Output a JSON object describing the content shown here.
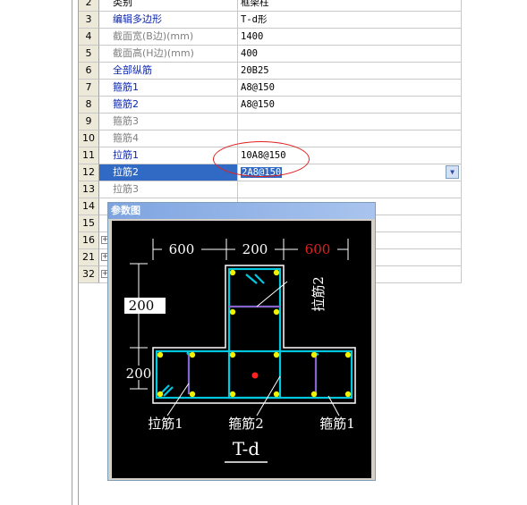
{
  "rows": [
    {
      "num": "2",
      "name": "类别",
      "value": "框架柱",
      "name_style": "black"
    },
    {
      "num": "3",
      "name": "编辑多边形",
      "value": "T-d形",
      "name_style": "blue"
    },
    {
      "num": "4",
      "name": "截面宽(B边)(mm)",
      "value": "1400",
      "name_style": "gray"
    },
    {
      "num": "5",
      "name": "截面高(H边)(mm)",
      "value": "400",
      "name_style": "gray"
    },
    {
      "num": "6",
      "name": "全部纵筋",
      "value": "20B25",
      "name_style": "blue"
    },
    {
      "num": "7",
      "name": "箍筋1",
      "value": "A8@150",
      "name_style": "blue"
    },
    {
      "num": "8",
      "name": "箍筋2",
      "value": "A8@150",
      "name_style": "blue"
    },
    {
      "num": "9",
      "name": "箍筋3",
      "value": "",
      "name_style": "gray"
    },
    {
      "num": "10",
      "name": "箍筋4",
      "value": "",
      "name_style": "gray"
    },
    {
      "num": "11",
      "name": "拉筋1",
      "value": "10A8@150",
      "name_style": "blue"
    },
    {
      "num": "12",
      "name": "拉筋2",
      "value": "2A8@150",
      "name_style": "selected"
    },
    {
      "num": "13",
      "name": "拉筋3",
      "value": "",
      "name_style": "gray"
    },
    {
      "num": "14",
      "name": "",
      "value": "",
      "name_style": "black"
    },
    {
      "num": "15",
      "name": "",
      "value": "",
      "name_style": "black"
    },
    {
      "num": "16",
      "name": "",
      "value": "",
      "name_style": "plus"
    },
    {
      "num": "21",
      "name": "",
      "value": "",
      "name_style": "plus"
    },
    {
      "num": "32",
      "name": "",
      "value": "",
      "name_style": "plus"
    }
  ],
  "dropdown_icon": "chevron-down-icon",
  "window": {
    "title": "参数图",
    "dim_left": "600",
    "dim_mid": "200",
    "dim_right": "600",
    "dim_top_height": "200",
    "dim_bottom_height": "200",
    "label_tie2": "拉筋2",
    "label_tie1": "拉筋1",
    "label_stirrup2": "箍筋2",
    "label_stirrup1": "箍筋1",
    "shape_name": "T-d"
  },
  "colors": {
    "selection": "#316ac5",
    "blue_label": "#0a24b0",
    "rebar": "#00c8e0",
    "bar_dot": "#f0f000",
    "highlight_dim": "#e02020"
  }
}
